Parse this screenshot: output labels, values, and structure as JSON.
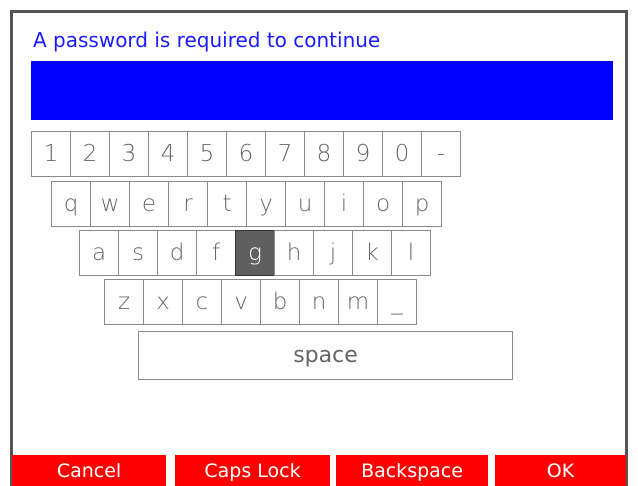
{
  "dialog": {
    "prompt": "A password is required to continue",
    "password_value": "",
    "field_color": "#0000ff",
    "prompt_color": "#1a1aff"
  },
  "keyboard": {
    "rows": [
      [
        "1",
        "2",
        "3",
        "4",
        "5",
        "6",
        "7",
        "8",
        "9",
        "0",
        "-"
      ],
      [
        "q",
        "w",
        "e",
        "r",
        "t",
        "y",
        "u",
        "i",
        "o",
        "p"
      ],
      [
        "a",
        "s",
        "d",
        "f",
        "g",
        "h",
        "j",
        "k",
        "l"
      ],
      [
        "z",
        "x",
        "c",
        "v",
        "b",
        "n",
        "m",
        "_"
      ]
    ],
    "space_label": "space",
    "highlighted_key": "g"
  },
  "buttons": {
    "cancel": "Cancel",
    "caps_lock": "Caps Lock",
    "backspace": "Backspace",
    "ok": "OK",
    "color": "#ff0000"
  }
}
